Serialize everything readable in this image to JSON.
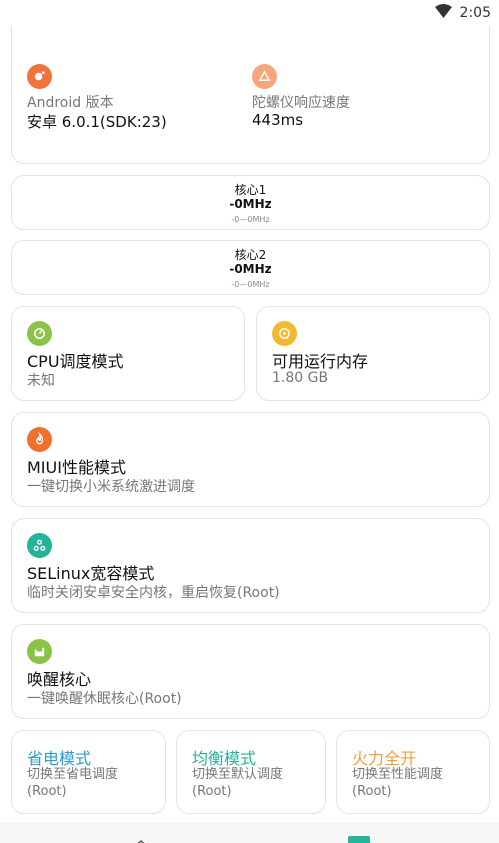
{
  "status_bar": {
    "time": "2:05",
    "wifi_icon": "wifi-icon"
  },
  "device_info": {
    "android_label": "Android 版本",
    "android_value": "安卓 6.0.1(SDK:23)",
    "gyro_label": "陀螺仪响应速度",
    "gyro_value": "443ms"
  },
  "cores": [
    {
      "name": "核心1",
      "freq": "-0MHz",
      "range": "-0—0MHz"
    },
    {
      "name": "核心2",
      "freq": "-0MHz",
      "range": "-0—0MHz"
    }
  ],
  "cpu_mode": {
    "title": "CPU调度模式",
    "value": "未知"
  },
  "memory": {
    "title": "可用运行内存",
    "value": "1.80 GB"
  },
  "miui": {
    "title": "MIUI性能模式",
    "subtitle": "一键切换小米系统激进调度"
  },
  "selinux": {
    "title": "SELinux宽容模式",
    "subtitle": "临时关闭安卓安全内核，重启恢复(Root)"
  },
  "wake": {
    "title": "唤醒核心",
    "subtitle": "一键唤醒休眠核心(Root)"
  },
  "modes": [
    {
      "title": "省电模式",
      "line1": "切换至省电调度",
      "line2": "(Root)",
      "color": "#2e9ad0"
    },
    {
      "title": "均衡模式",
      "line1": "切换至默认调度",
      "line2": "(Root)",
      "color": "#26b39a"
    },
    {
      "title": "火力全开",
      "line1": "切换至性能调度",
      "line2": "(Root)",
      "color": "#f0a030"
    }
  ],
  "colors": {
    "android_icon": "#f0743c",
    "gyro_icon": "#f5a77a",
    "cpu_icon": "#8bc34a",
    "memory_icon": "#f5b731",
    "miui_icon": "#f0712c",
    "selinux_icon": "#26b39a",
    "wake_icon": "#8bc34a"
  }
}
